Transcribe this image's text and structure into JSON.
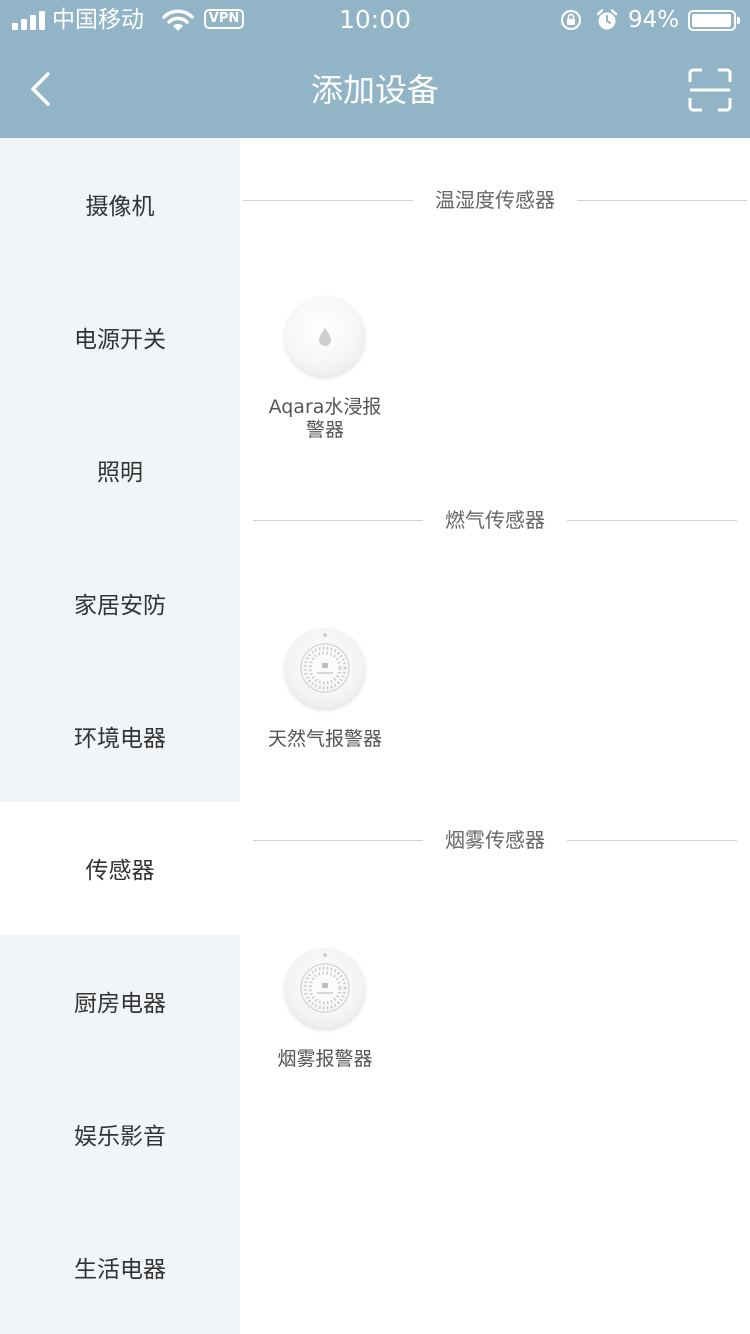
{
  "status_bar": {
    "carrier": "中国移动",
    "vpn": "VPN",
    "time": "10:00",
    "battery": "94%",
    "battery_level": 0.94
  },
  "header": {
    "title": "添加设备",
    "back_icon": "chevron-left-icon",
    "scan_icon": "scan-icon"
  },
  "sidebar": {
    "active_index": 5,
    "items": [
      {
        "label": "摄像机"
      },
      {
        "label": "电源开关"
      },
      {
        "label": "照明"
      },
      {
        "label": "家居安防"
      },
      {
        "label": "环境电器"
      },
      {
        "label": "传感器"
      },
      {
        "label": "厨房电器"
      },
      {
        "label": "娱乐影音"
      },
      {
        "label": "生活电器"
      }
    ]
  },
  "sections": [
    {
      "title": "温湿度传感器",
      "devices": [
        {
          "name_line1": "Aqara水浸报",
          "name_line2": "警器",
          "image": "water-leak-sensor-icon"
        }
      ]
    },
    {
      "title": "燃气传感器",
      "devices": [
        {
          "name_line1": "天然气报警器",
          "image": "gas-alarm-icon"
        }
      ]
    },
    {
      "title": "烟雾传感器",
      "devices": [
        {
          "name_line1": "烟雾报警器",
          "image": "smoke-alarm-icon"
        }
      ]
    }
  ],
  "colors": {
    "header_bg": "#91b4c6",
    "sidebar_bg": "#f1f5f8",
    "active_bg": "#ffffff"
  }
}
